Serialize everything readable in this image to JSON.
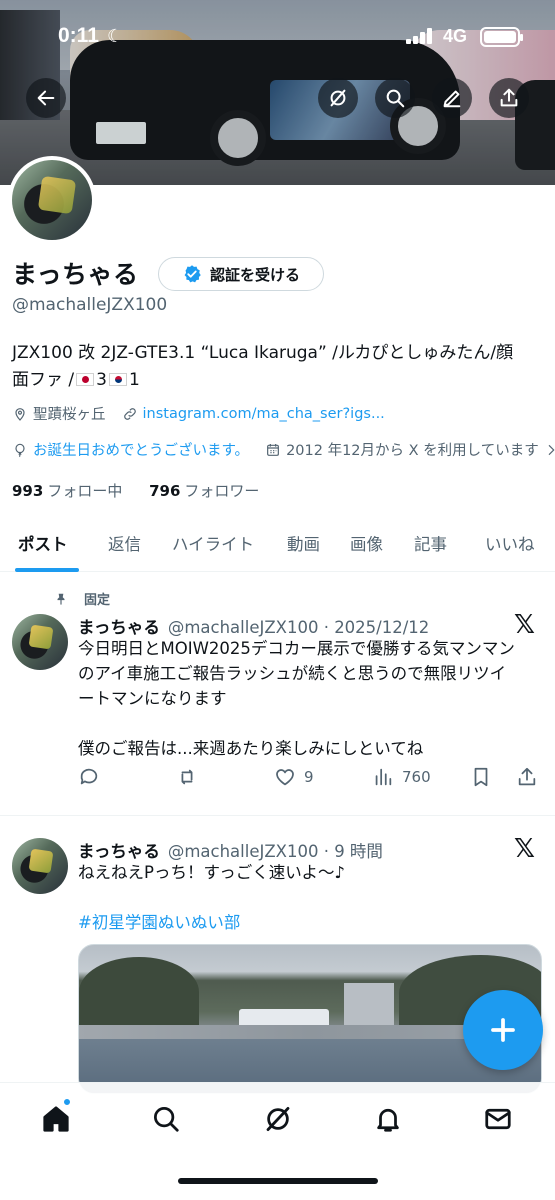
{
  "status_bar": {
    "time": "0:11",
    "network": "4G"
  },
  "profile": {
    "name": "まっちゃる",
    "verify_label": "認証を受ける",
    "handle": "@machalleJZX100",
    "bio_line1": "JZX100 改 2JZ-GTE3.1 “Luca Ikaruga” /ルカぴとしゅみたん/顔",
    "bio_line2_prefix": "面ファ /",
    "bio_jp_count": "3",
    "bio_kr_count": "1",
    "location": "聖蹟桜ヶ丘",
    "website": "instagram.com/ma_cha_ser?igs...",
    "birthday": "お誕生日おめでとうございます。",
    "joined": "2012 年12月から X を利用しています",
    "following_count": "993",
    "following_label": "フォロー中",
    "followers_count": "796",
    "followers_label": "フォロワー"
  },
  "tabs": [
    "ポスト",
    "返信",
    "ハイライト",
    "動画",
    "画像",
    "記事",
    "いいね"
  ],
  "pinned_label": "固定",
  "posts": [
    {
      "name": "まっちゃる",
      "handle_time": "@machalleJZX100 · 2025/12/12",
      "text1": "今日明日とMOIW2025デコカー展示で優勝する気マンマン",
      "text2": "のアイ車施工ご報告ラッシュが続くと思うので無限リツイ",
      "text3": "ートマンになります",
      "text4": "僕のご報告は...来週あたり楽しみにしといてね",
      "likes": "9",
      "views": "760"
    },
    {
      "name": "まっちゃる",
      "handle_time": "@machalleJZX100 · 9 時間",
      "text1": "ねえねえPっち！すっごく速いよ〜♪",
      "hashtag": "#初星学園ぬいぬい部"
    }
  ],
  "icons": {
    "back": "arrow-left-icon",
    "grok": "grok-icon",
    "search": "search-icon",
    "edit": "edit-icon",
    "share": "share-icon"
  },
  "colors": {
    "accent": "#1d9bf0",
    "text": "#0f1419",
    "muted": "#536471"
  }
}
